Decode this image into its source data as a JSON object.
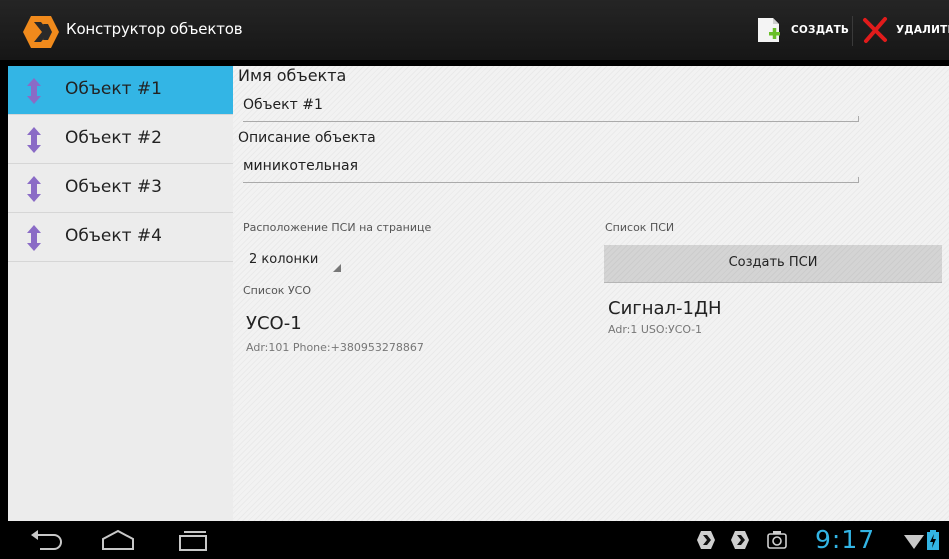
{
  "actionbar": {
    "title": "Конструктор объектов",
    "create_label": "СОЗДАТЬ",
    "delete_label": "УДАЛИТЬ",
    "app_icon": "app-logo-icon"
  },
  "sidebar": {
    "items": [
      {
        "label": "Объект #1",
        "active": true
      },
      {
        "label": "Объект #2",
        "active": false
      },
      {
        "label": "Объект #3",
        "active": false
      },
      {
        "label": "Объект #4",
        "active": false
      }
    ]
  },
  "form": {
    "name_label": "Имя объекта",
    "name_value": "Объект #1",
    "desc_label": "Описание объекта",
    "desc_value": "миникотельная",
    "layout_label": "Расположение ПСИ на странице",
    "layout_value": "2 колонки",
    "uso_list_label": "Список УСО",
    "psi_list_label": "Список ПСИ",
    "create_psi_label": "Создать ПСИ"
  },
  "uso_items": [
    {
      "title": "УСО-1",
      "subtitle": "Adr:101 Phone:+380953278867"
    }
  ],
  "psi_items": [
    {
      "title": "Сигнал-1ДН",
      "subtitle": "Adr:1 USO:УСО-1"
    }
  ],
  "statusbar": {
    "time": "9:17"
  },
  "colors": {
    "accent": "#33b5e5",
    "actionbar": "#1c1c1c",
    "sidebar": "#ececec"
  }
}
